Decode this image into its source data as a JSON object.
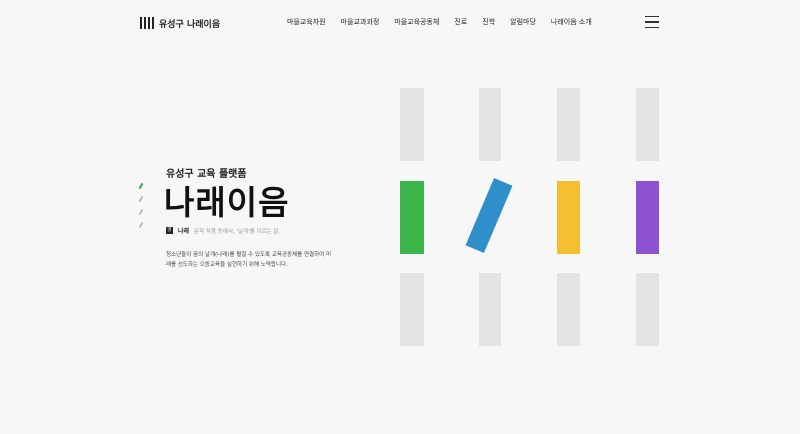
{
  "header": {
    "logo_text": "유성구 나래이음",
    "nav": [
      "마을교육자원",
      "마을교과과정",
      "마을교육공동체",
      "진로",
      "진학",
      "알림마당",
      "나래이음 소개"
    ]
  },
  "hero": {
    "subtitle": "유성구 교육 플랫폼",
    "title": "나래이음",
    "definition_badge": "명",
    "definition_word": "나래",
    "definition_text": "문학 작품 등에서, '날개'를 이르는 말.",
    "description": "청소년들이 꿈의 날개(나래)를 펼칠 수 있도록 교육공동체를 연결하여 미래를 선도하는 으뜸교육을 실현하기 위해 노력합니다."
  },
  "colors": {
    "green": "#3bb54a",
    "blue": "#2f8fca",
    "yellow": "#f4bf30",
    "purple": "#8e51d0",
    "gray": "#e4e4e4"
  },
  "icons": {
    "menu": "hamburger-menu-icon",
    "logo": "logo-bars-icon"
  }
}
